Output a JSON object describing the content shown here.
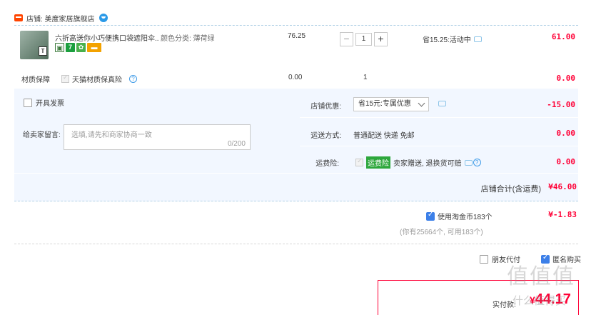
{
  "shop": {
    "name": "店铺: 美度家居旗舰店"
  },
  "item": {
    "title": "六折高送你小巧便携口袋遮阳伞...",
    "sku": "颜色分类: 薄荷绿",
    "image_badge": "T",
    "badges": [
      "7"
    ],
    "unit_price": "76.25",
    "qty_minus": "−",
    "qty": "1",
    "qty_plus": "+",
    "promo": "省15.25:活动中",
    "subtotal": "61.00"
  },
  "insurance": {
    "label": "材质保障",
    "option": "天猫材质保真险",
    "help": "?",
    "price": "0.00",
    "qty": "1",
    "subtotal": "0.00"
  },
  "invoice": {
    "label": "开具发票"
  },
  "message": {
    "label": "给卖家留言:",
    "placeholder": "选填,请先和商家协商一致",
    "count": "0/200"
  },
  "shop_coupon": {
    "label": "店铺优惠:",
    "selected": "省15元:专属优惠",
    "amount": "-15.00"
  },
  "shipping": {
    "label": "运送方式:",
    "value": "普通配送 快递 免邮",
    "amount": "0.00"
  },
  "freight_ins": {
    "label": "运费险:",
    "tag": "运费险",
    "desc": "卖家赠送, 退换货可赔",
    "amount": "0.00"
  },
  "shop_total": {
    "label": "店铺合计(含运费)",
    "value": "¥46.00"
  },
  "coins": {
    "label": "使用淘金币183个",
    "value": "¥-1.83",
    "note": "(你有25664个, 可用183个)"
  },
  "friend_pay": {
    "label": "朋友代付"
  },
  "anonymous": {
    "label": "匿名购买"
  },
  "payment": {
    "label": "实付款:",
    "currency": "¥",
    "value": "44.17"
  },
  "watermark": {
    "text": "值值值",
    "site": "什么值得买"
  }
}
